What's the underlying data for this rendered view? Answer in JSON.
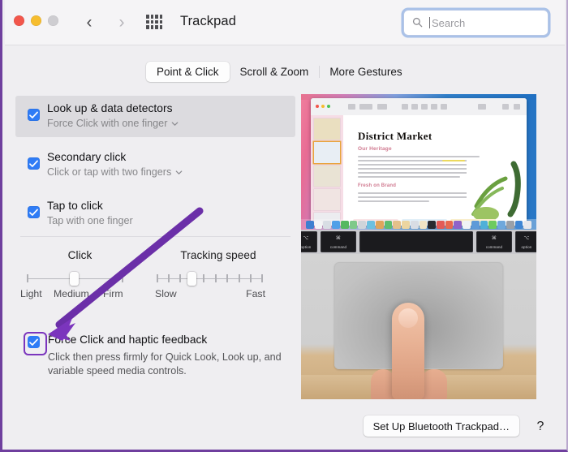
{
  "window": {
    "title": "Trackpad",
    "traffic_lights": [
      "close-red",
      "minimize-yellow",
      "zoom-disabled-gray"
    ],
    "back_glyph": "‹",
    "forward_glyph": "›"
  },
  "search": {
    "placeholder": "Search",
    "value": "",
    "icon": "search-icon"
  },
  "tabs": [
    {
      "label": "Point & Click",
      "selected": true
    },
    {
      "label": "Scroll & Zoom",
      "selected": false
    },
    {
      "label": "More Gestures",
      "selected": false
    }
  ],
  "options": [
    {
      "title": "Look up & data detectors",
      "subtitle": "Force Click with one finger",
      "has_dropdown": true,
      "checked": true,
      "highlighted": true
    },
    {
      "title": "Secondary click",
      "subtitle": "Click or tap with two fingers",
      "has_dropdown": true,
      "checked": true,
      "highlighted": false
    },
    {
      "title": "Tap to click",
      "subtitle": "Tap with one finger",
      "has_dropdown": false,
      "checked": true,
      "highlighted": false
    }
  ],
  "sliders": {
    "click": {
      "title": "Click",
      "labels": [
        "Light",
        "Medium",
        "Firm"
      ],
      "ticks": 3,
      "value_index": 1
    },
    "tracking": {
      "title": "Tracking speed",
      "labels": [
        "Slow",
        "Fast"
      ],
      "ticks": 10,
      "value_index": 3
    }
  },
  "force_click": {
    "title": "Force Click and haptic feedback",
    "description": "Click then press firmly for Quick Look, Look up, and variable speed media controls.",
    "checked": true,
    "annotation_color": "#7b35bd"
  },
  "footer": {
    "bluetooth_button": "Set Up Bluetooth Trackpad…",
    "help_button": "?"
  },
  "preview": {
    "document_title": "District Market",
    "section_heading": "Our Heritage",
    "second_heading": "Fresh on Brand",
    "keys": [
      "option",
      "command",
      "",
      "command",
      "option"
    ],
    "key_glyphs": [
      "⌥",
      "⌘",
      "",
      "⌘",
      "⌥"
    ]
  },
  "colors": {
    "accent_checkbox": "#2f7cf6",
    "annotation_purple": "#7b35bd",
    "window_bg": "#efeef1",
    "titlebar_bg": "#f5f4f6",
    "search_focus_ring": "#6a98dc"
  }
}
